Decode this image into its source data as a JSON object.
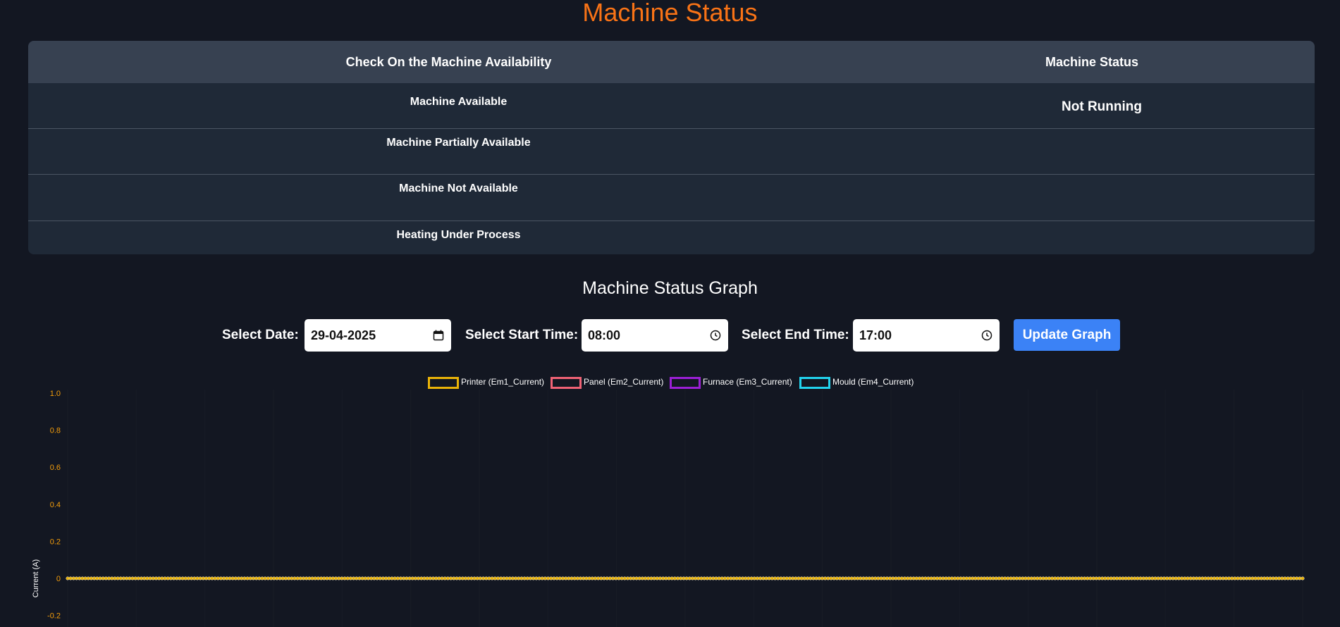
{
  "header": {
    "title": "Machine Status"
  },
  "status_table": {
    "col_availability": "Check On the Machine Availability",
    "col_status": "Machine Status",
    "rows": [
      {
        "label": "Machine Available",
        "status": "Not Running"
      },
      {
        "label": "Machine Partially Available",
        "status": ""
      },
      {
        "label": "Machine Not Available",
        "status": ""
      },
      {
        "label": "Heating Under Process",
        "status": ""
      }
    ]
  },
  "graph": {
    "title": "Machine Status Graph",
    "date_label": "Select Date:",
    "date_value": "29-04-2025",
    "start_label": "Select Start Time:",
    "start_value": "08:00",
    "end_label": "Select End Time:",
    "end_value": "17:00",
    "update_label": "Update Graph"
  },
  "chart_data": {
    "type": "line",
    "ylabel": "Current (A)",
    "ylim": [
      -0.2,
      1.0
    ],
    "y_ticks": [
      "1.0",
      "0.8",
      "0.6",
      "0.4",
      "0.2",
      "0",
      "-0.2"
    ],
    "tick_color": "#f59e0b",
    "legend_position": "top",
    "series": [
      {
        "name": "Printer (Em1_Current)",
        "color": "#eab308",
        "values": [
          0,
          0,
          0,
          0,
          0
        ]
      },
      {
        "name": "Panel (Em2_Current)",
        "color": "#f06275",
        "values": [
          0,
          0,
          0,
          0,
          0
        ]
      },
      {
        "name": "Furnace (Em3_Current)",
        "color": "#9b1fd6",
        "values": [
          0,
          0,
          0,
          0,
          0
        ]
      },
      {
        "name": "Mould (Em4_Current)",
        "color": "#22d3ee",
        "values": [
          0,
          0,
          0,
          0,
          0
        ]
      }
    ]
  }
}
